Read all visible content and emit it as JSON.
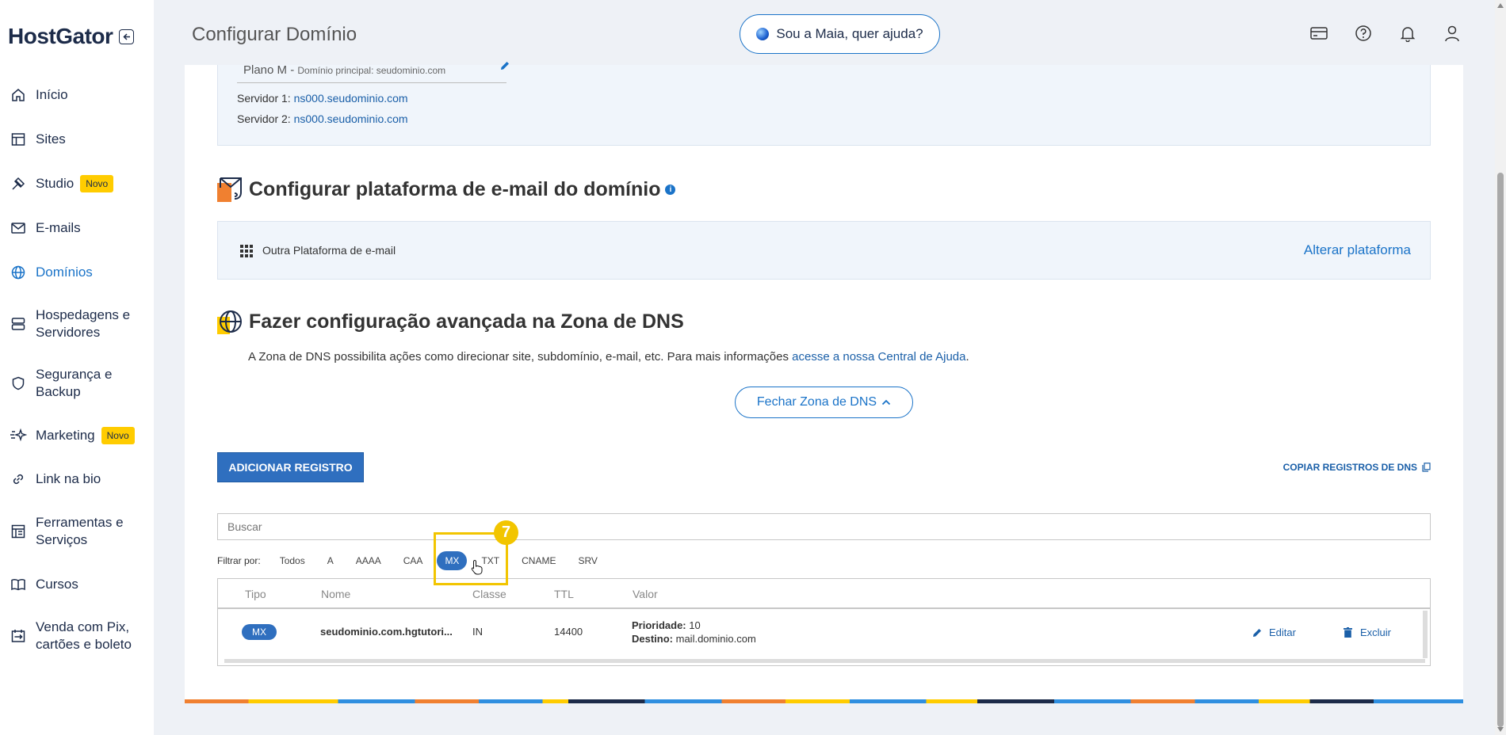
{
  "brand": {
    "name": "HostGator"
  },
  "sidebar": {
    "items": [
      {
        "label": "Início",
        "icon": "home-icon"
      },
      {
        "label": "Sites",
        "icon": "layout-icon"
      },
      {
        "label": "Studio",
        "icon": "studio-icon",
        "badge": "Novo"
      },
      {
        "label": "E-mails",
        "icon": "mail-icon"
      },
      {
        "label": "Domínios",
        "icon": "globe-icon",
        "active": true
      },
      {
        "label_1": "Hospedagens e",
        "label_2": "Servidores",
        "icon": "server-icon"
      },
      {
        "label_1": "Segurança e",
        "label_2": "Backup",
        "icon": "shield-icon"
      },
      {
        "label": "Marketing",
        "icon": "sparkle-icon",
        "badge": "Novo"
      },
      {
        "label": "Link na bio",
        "icon": "link-icon"
      },
      {
        "label_1": "Ferramentas e",
        "label_2": "Serviços",
        "icon": "tools-icon"
      },
      {
        "label": "Cursos",
        "icon": "book-icon"
      },
      {
        "label_1": "Venda com Pix,",
        "label_2": "cartões e boleto",
        "icon": "payment-icon"
      }
    ]
  },
  "header": {
    "title": "Configurar Domínio",
    "maia_button": "Sou a Maia, quer ajuda?"
  },
  "nameservers": {
    "plan": "Plano M -",
    "plan_domain": "Domínio principal: seudominio.com",
    "server1_label": "Servidor 1:",
    "server1_value": "ns000.seudominio.com",
    "server2_label": "Servidor 2:",
    "server2_value": "ns000.seudominio.com"
  },
  "email_section": {
    "title": "Configurar plataforma de e-mail do domínio",
    "info": "i",
    "platform": "Outra Plataforma de e-mail",
    "change_link": "Alterar plataforma"
  },
  "dns_section": {
    "title": "Fazer configuração avançada na Zona de DNS",
    "desc": "A Zona de DNS possibilita ações como direcionar site, subdomínio, e-mail, etc. Para mais informações",
    "desc_link": "acesse a nossa Central de Ajuda",
    "desc_end": ".",
    "close_button": "Fechar Zona de DNS",
    "add_button": "ADICIONAR REGISTRO",
    "copy_button": "COPIAR REGISTROS DE DNS",
    "search_placeholder": "Buscar",
    "filter_label": "Filtrar por:",
    "filters": [
      "Todos",
      "A",
      "AAAA",
      "CAA",
      "MX",
      "TXT",
      "CNAME",
      "SRV"
    ],
    "active_filter": "MX",
    "tutorial_step": "7",
    "table": {
      "headers": [
        "Tipo",
        "Nome",
        "Classe",
        "TTL",
        "Valor"
      ],
      "rows": [
        {
          "type": "MX",
          "name": "seudominio.com.hgtutori...",
          "class": "IN",
          "ttl": "14400",
          "priority_label": "Prioridade:",
          "priority": "10",
          "dest_label": "Destino:",
          "dest": "mail.dominio.com",
          "edit": "Editar",
          "delete": "Excluir"
        }
      ]
    }
  },
  "colors": {
    "accent": "#1a73c8",
    "brand_dark": "#1c2b49",
    "badge": "#ffcc00",
    "highlight": "#f2c500"
  }
}
